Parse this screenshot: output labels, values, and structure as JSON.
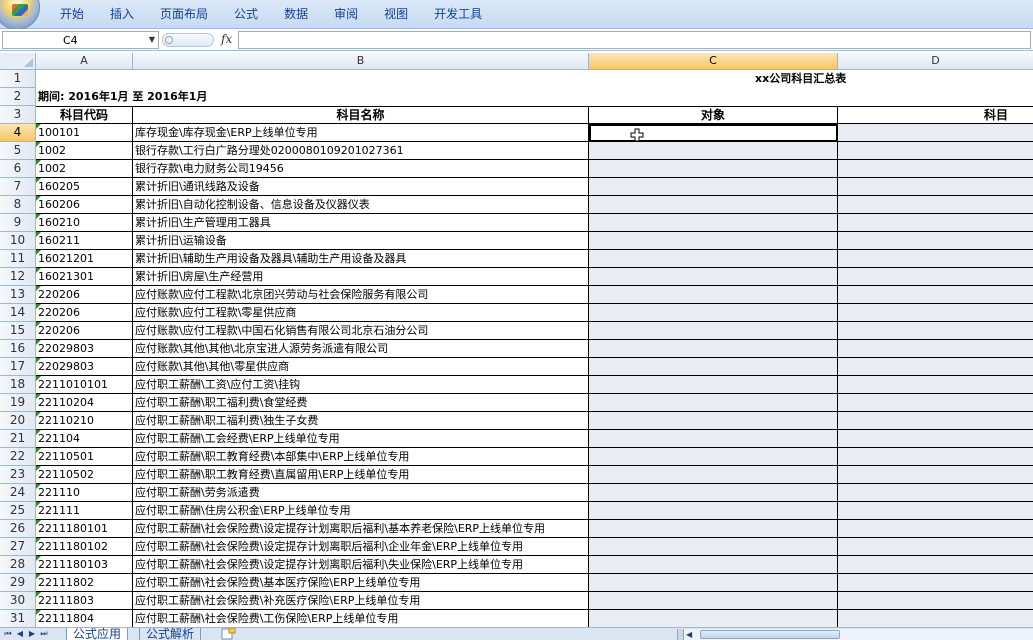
{
  "ribbon": {
    "tabs": [
      "开始",
      "插入",
      "页面布局",
      "公式",
      "数据",
      "审阅",
      "视图",
      "开发工具"
    ]
  },
  "formula_bar": {
    "name_box": "C4",
    "fx_label": "fx",
    "formula": ""
  },
  "columns": [
    "A",
    "B",
    "C",
    "D"
  ],
  "sheet": {
    "title": "xx公司科目汇总表",
    "period": "期间: 2016年1月  至  2016年1月",
    "headers": {
      "code": "科目代码",
      "name": "科目名称",
      "object": "对象",
      "subject": "科目"
    },
    "rows": [
      {
        "row": "4",
        "code": "100101",
        "name": "库存现金\\库存现金\\ERP上线单位专用"
      },
      {
        "row": "5",
        "code": "1002",
        "name": "银行存款\\工行白广路分理处0200080109201027361"
      },
      {
        "row": "6",
        "code": "1002",
        "name": "银行存款\\电力财务公司19456"
      },
      {
        "row": "7",
        "code": "160205",
        "name": "累计折旧\\通讯线路及设备"
      },
      {
        "row": "8",
        "code": "160206",
        "name": "累计折旧\\自动化控制设备、信息设备及仪器仪表"
      },
      {
        "row": "9",
        "code": "160210",
        "name": "累计折旧\\生产管理用工器具"
      },
      {
        "row": "10",
        "code": "160211",
        "name": "累计折旧\\运输设备"
      },
      {
        "row": "11",
        "code": "16021201",
        "name": "累计折旧\\辅助生产用设备及器具\\辅助生产用设备及器具"
      },
      {
        "row": "12",
        "code": "16021301",
        "name": "累计折旧\\房屋\\生产经营用"
      },
      {
        "row": "13",
        "code": "220206",
        "name": "应付账款\\应付工程款\\北京团兴劳动与社会保险服务有限公司"
      },
      {
        "row": "14",
        "code": "220206",
        "name": "应付账款\\应付工程款\\零星供应商"
      },
      {
        "row": "15",
        "code": "220206",
        "name": "应付账款\\应付工程款\\中国石化销售有限公司北京石油分公司"
      },
      {
        "row": "16",
        "code": "22029803",
        "name": "应付账款\\其他\\其他\\北京宝进人源劳务派遣有限公司"
      },
      {
        "row": "17",
        "code": "22029803",
        "name": "应付账款\\其他\\其他\\零星供应商"
      },
      {
        "row": "18",
        "code": "2211010101",
        "name": "应付职工薪酬\\工资\\应付工资\\挂钩"
      },
      {
        "row": "19",
        "code": "22110204",
        "name": "应付职工薪酬\\职工福利费\\食堂经费"
      },
      {
        "row": "20",
        "code": "22110210",
        "name": "应付职工薪酬\\职工福利费\\独生子女费"
      },
      {
        "row": "21",
        "code": "221104",
        "name": "应付职工薪酬\\工会经费\\ERP上线单位专用"
      },
      {
        "row": "22",
        "code": "22110501",
        "name": "应付职工薪酬\\职工教育经费\\本部集中\\ERP上线单位专用"
      },
      {
        "row": "23",
        "code": "22110502",
        "name": "应付职工薪酬\\职工教育经费\\直属留用\\ERP上线单位专用"
      },
      {
        "row": "24",
        "code": "221110",
        "name": "应付职工薪酬\\劳务派遣费"
      },
      {
        "row": "25",
        "code": "221111",
        "name": "应付职工薪酬\\住房公积金\\ERP上线单位专用"
      },
      {
        "row": "26",
        "code": "2211180101",
        "name": "应付职工薪酬\\社会保险费\\设定提存计划离职后福利\\基本养老保险\\ERP上线单位专用"
      },
      {
        "row": "27",
        "code": "2211180102",
        "name": "应付职工薪酬\\社会保险费\\设定提存计划离职后福利\\企业年金\\ERP上线单位专用"
      },
      {
        "row": "28",
        "code": "2211180103",
        "name": "应付职工薪酬\\社会保险费\\设定提存计划离职后福利\\失业保险\\ERP上线单位专用"
      },
      {
        "row": "29",
        "code": "22111802",
        "name": "应付职工薪酬\\社会保险费\\基本医疗保险\\ERP上线单位专用"
      },
      {
        "row": "30",
        "code": "22111803",
        "name": "应付职工薪酬\\社会保险费\\补充医疗保险\\ERP上线单位专用"
      },
      {
        "row": "31",
        "code": "22111804",
        "name": "应付职工薪酬\\社会保险费\\工伤保险\\ERP上线单位专用"
      }
    ]
  },
  "row_labels_top": [
    "1",
    "2",
    "3"
  ],
  "sheet_tabs": [
    "公式应用",
    "公式解析"
  ],
  "colors": {
    "ribbon_bg": "#c7daf2",
    "selected_header": "#f5c66a",
    "error_indicator": "#2e8b2e",
    "shaded_cell": "#e9ecf2"
  }
}
